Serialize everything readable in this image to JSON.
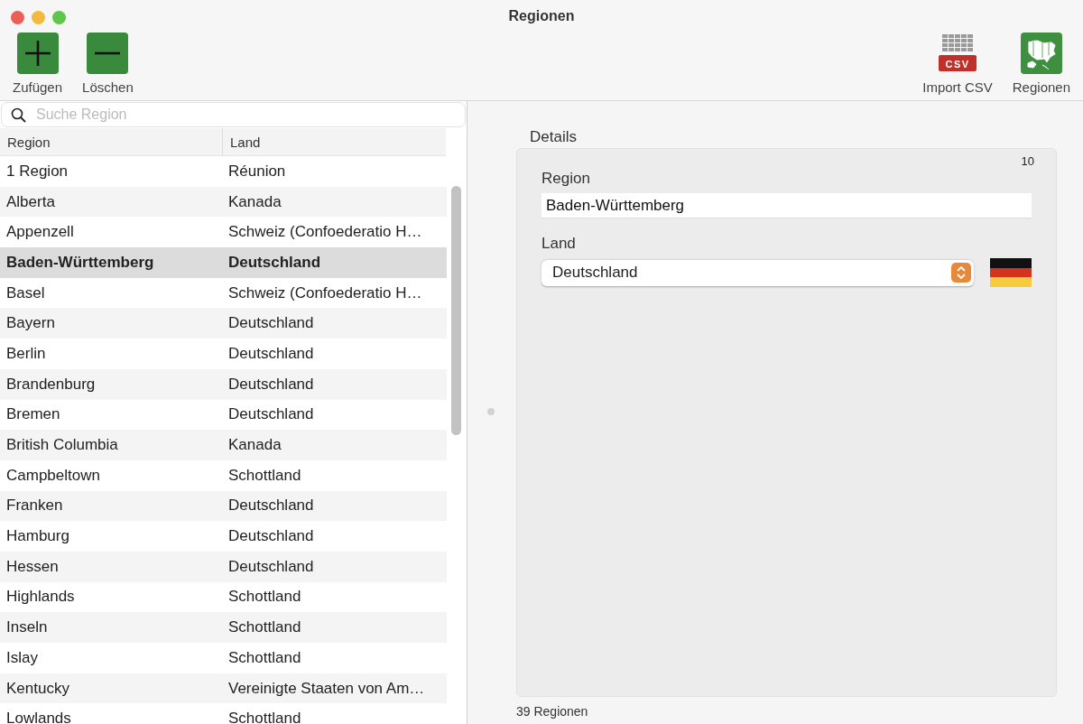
{
  "window": {
    "title": "Regionen"
  },
  "toolbar": {
    "left": [
      {
        "kind": "add",
        "label": "Zufügen"
      },
      {
        "kind": "remove",
        "label": "Löschen"
      }
    ],
    "right": [
      {
        "kind": "csv",
        "label": "Import CSV",
        "badge": "CSV"
      },
      {
        "kind": "map",
        "label": "Regionen"
      }
    ]
  },
  "search": {
    "placeholder": "Suche Region"
  },
  "table": {
    "columns": [
      "Region",
      "Land"
    ],
    "rows": [
      {
        "cells": [
          "1 Region",
          "Réunion"
        ],
        "selected": false
      },
      {
        "cells": [
          "Alberta",
          "Kanada"
        ],
        "selected": false
      },
      {
        "cells": [
          "Appenzell",
          "Schweiz (Confoederatio H…"
        ],
        "selected": false
      },
      {
        "cells": [
          "Baden-Württemberg",
          "Deutschland"
        ],
        "selected": true
      },
      {
        "cells": [
          "Basel",
          "Schweiz (Confoederatio H…"
        ],
        "selected": false
      },
      {
        "cells": [
          "Bayern",
          "Deutschland"
        ],
        "selected": false
      },
      {
        "cells": [
          "Berlin",
          "Deutschland"
        ],
        "selected": false
      },
      {
        "cells": [
          "Brandenburg",
          "Deutschland"
        ],
        "selected": false
      },
      {
        "cells": [
          "Bremen",
          "Deutschland"
        ],
        "selected": false
      },
      {
        "cells": [
          "British Columbia",
          "Kanada"
        ],
        "selected": false
      },
      {
        "cells": [
          "Campbeltown",
          "Schottland"
        ],
        "selected": false
      },
      {
        "cells": [
          "Franken",
          "Deutschland"
        ],
        "selected": false
      },
      {
        "cells": [
          "Hamburg",
          "Deutschland"
        ],
        "selected": false
      },
      {
        "cells": [
          "Hessen",
          "Deutschland"
        ],
        "selected": false
      },
      {
        "cells": [
          "Highlands",
          "Schottland"
        ],
        "selected": false
      },
      {
        "cells": [
          "Inseln",
          "Schottland"
        ],
        "selected": false
      },
      {
        "cells": [
          "Islay",
          "Schottland"
        ],
        "selected": false
      },
      {
        "cells": [
          "Kentucky",
          "Vereinigte Staaten von Am…"
        ],
        "selected": false
      },
      {
        "cells": [
          "Lowlands",
          "Schottland"
        ],
        "selected": false
      }
    ]
  },
  "details": {
    "title": "Details",
    "counter": "10",
    "region_label": "Region",
    "region_value": "Baden-Württemberg",
    "land_label": "Land",
    "land_value": "Deutschland"
  },
  "status_bar": "39 Regionen"
}
